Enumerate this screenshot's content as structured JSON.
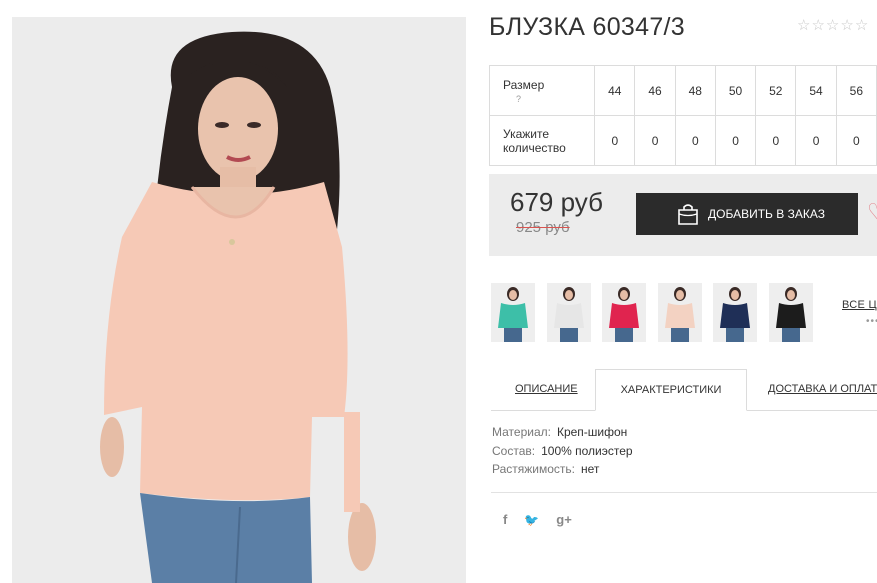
{
  "product": {
    "title": "БЛУЗКА 60347/3",
    "rating_stars": [
      "☆",
      "☆",
      "☆",
      "☆",
      "☆"
    ],
    "image_alt": "Женщина в персиковой блузке"
  },
  "sizes": {
    "size_label": "Размер",
    "help_glyph": "?",
    "qty_label_1": "Укажите",
    "qty_label_2": "количество",
    "values": [
      "44",
      "46",
      "48",
      "50",
      "52",
      "54",
      "56"
    ],
    "quantities": [
      "0",
      "0",
      "0",
      "0",
      "0",
      "0",
      "0"
    ]
  },
  "pricing": {
    "price": "679 руб",
    "old_price": "925 руб",
    "add_button": "ДОБАВИТЬ В ЗАКАЗ",
    "heart_glyph": "♡"
  },
  "colors": {
    "swatches": [
      "#3dbfa8",
      "#e6e6e6",
      "#e0244f",
      "#f3d2c2",
      "#1f2f57",
      "#1c1c1c"
    ],
    "all_colors_label": "ВСЕ ЦВЕТА",
    "more_glyph": "•••"
  },
  "tabs": {
    "description": "ОПИСАНИЕ",
    "characteristics": "ХАРАКТЕРИСТИКИ",
    "delivery": "ДОСТАВКА И ОПЛАТА"
  },
  "specs": {
    "material_label": "Материал:",
    "material_value": "Креп-шифон",
    "composition_label": "Состав:",
    "composition_value": "100% полиэстер",
    "stretch_label": "Растяжимость:",
    "stretch_value": "нет"
  },
  "social": {
    "facebook": "f",
    "twitter": "🐦",
    "googleplus": "g+"
  }
}
